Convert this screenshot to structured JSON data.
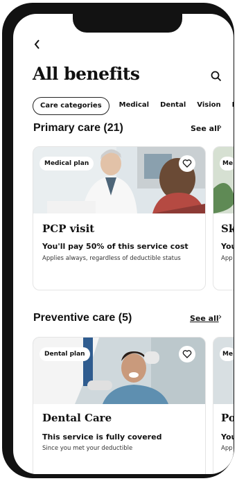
{
  "nav": {
    "back_icon": "chevron-left-icon"
  },
  "header": {
    "title": "All benefits",
    "search_icon": "search-icon"
  },
  "chips": [
    "Care categories",
    "Medical",
    "Dental",
    "Vision",
    "Em"
  ],
  "sections": [
    {
      "title": "Primary care (21)",
      "see_all": "See all",
      "cards": [
        {
          "tag": "Medical plan",
          "title": "PCP visit",
          "cost": "You'll pay 50% of this service cost",
          "note": "Applies always, regardless of deductible status"
        },
        {
          "tag": "Me",
          "title": "Sk",
          "cost": "You",
          "note": "App"
        }
      ]
    },
    {
      "title": "Preventive care (5)",
      "see_all": "See all",
      "cards": [
        {
          "tag": "Dental plan",
          "title": "Dental Care",
          "cost": "This service is fully covered",
          "note": "Since you met your deductible"
        },
        {
          "tag": "Me",
          "title": "Po",
          "cost": "You",
          "note": "App"
        }
      ]
    }
  ],
  "colors": {
    "frame": "#121212",
    "text": "#111111",
    "card_border": "#e4e4e4"
  }
}
